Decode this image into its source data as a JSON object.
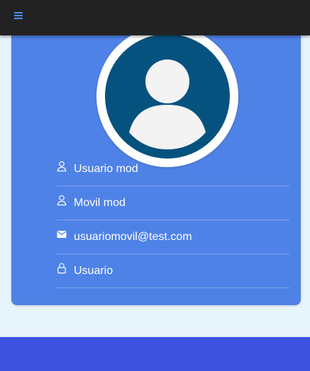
{
  "profile": {
    "name": "Usuario mod",
    "lastname": "Movil mod",
    "email": "usuariomovil@test.com",
    "role": "Usuario"
  },
  "icons": {
    "menu": "menu-icon",
    "avatar": "user-avatar-icon",
    "name": "person-icon",
    "lastname": "person-icon",
    "email": "mail-icon",
    "role": "lock-icon"
  },
  "colors": {
    "topbar": "#222222",
    "menu_icon": "#4f8ef7",
    "card": "#4f82e6",
    "background": "#e8f4fb",
    "avatar_fill": "#06527f",
    "bottom_bar": "#3e54e0"
  }
}
